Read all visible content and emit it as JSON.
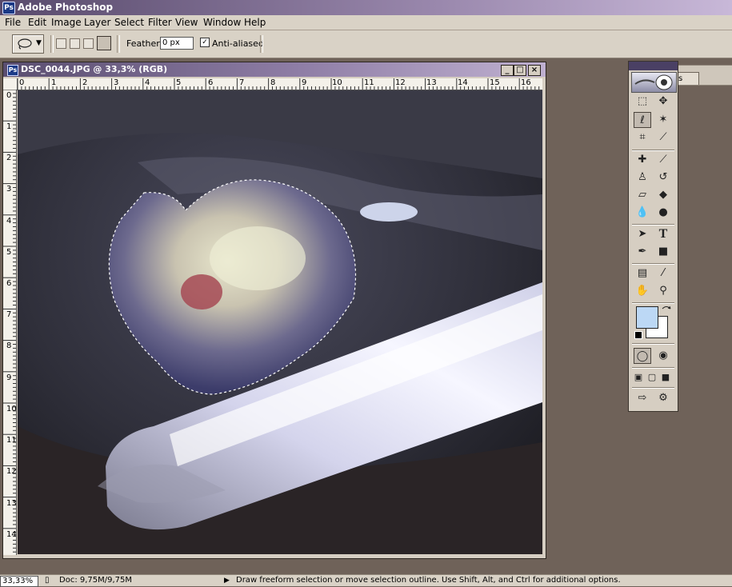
{
  "app": {
    "title": "Adobe Photoshop"
  },
  "menu": [
    "File",
    "Edit",
    "Image",
    "Layer",
    "Select",
    "Filter",
    "View",
    "Window",
    "Help"
  ],
  "options": {
    "feather_label": "Feather:",
    "feather_value": "0 px",
    "antialias_label": "Anti-aliased",
    "antialias_checked": true,
    "palette_tab": "Brushes"
  },
  "document": {
    "title": "DSC_0044.JPG @ 33,3% (RGB)",
    "ruler_h": [
      "0",
      "1",
      "2",
      "3",
      "4",
      "5",
      "6",
      "7",
      "8",
      "9",
      "10",
      "11",
      "12",
      "13",
      "14",
      "15",
      "16"
    ],
    "ruler_v": [
      "0",
      "1",
      "2",
      "3",
      "4",
      "5",
      "6",
      "7",
      "8",
      "9",
      "10",
      "11",
      "12",
      "13",
      "14"
    ]
  },
  "toolbox": {
    "foreground_color": "#bcd8f5",
    "background_color": "#ffffff",
    "tools": [
      "marquee-tool",
      "move-tool",
      "lasso-tool",
      "magic-wand-tool",
      "crop-tool",
      "slice-tool",
      "healing-brush-tool",
      "brush-tool",
      "clone-stamp-tool",
      "history-brush-tool",
      "eraser-tool",
      "paint-bucket-tool",
      "blur-tool",
      "burn-tool",
      "path-selection-tool",
      "type-tool",
      "pen-tool",
      "rectangle-tool",
      "notes-tool",
      "eyedropper-tool",
      "hand-tool",
      "zoom-tool"
    ],
    "active_tool": "lasso-tool"
  },
  "status": {
    "zoom": "33,33%",
    "doc": "Doc: 9,75M/9,75M",
    "message": "Draw freeform selection or move selection outline.  Use Shift, Alt, and Ctrl for additional options."
  }
}
